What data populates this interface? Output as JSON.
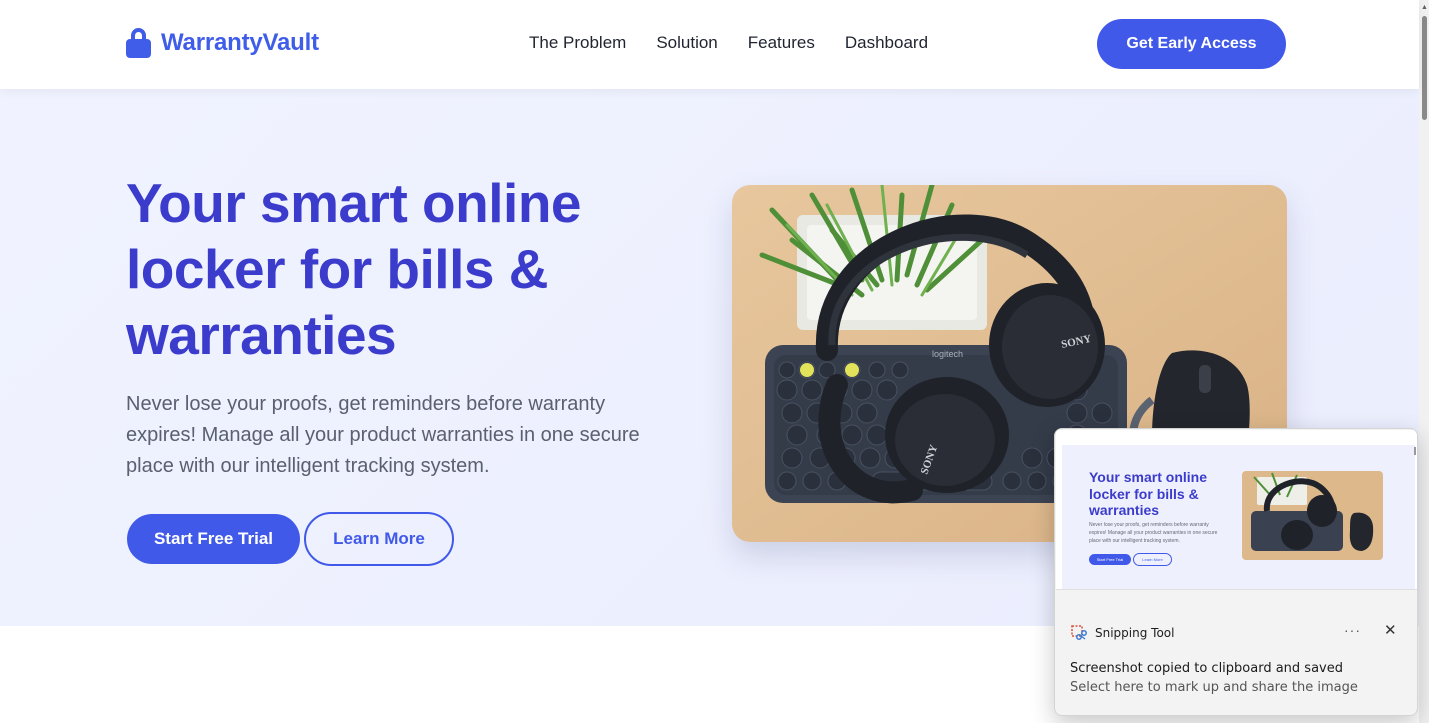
{
  "header": {
    "logo_text": "WarrantyVault",
    "logo_icon": "lock-icon",
    "nav": [
      "The Problem",
      "Solution",
      "Features",
      "Dashboard"
    ],
    "cta": "Get Early Access"
  },
  "hero": {
    "title": "Your smart online locker for bills & warranties",
    "subtitle": "Never lose your proofs, get reminders before warranty expires! Manage all your product warranties in one secure place with our intelligent tracking system.",
    "primary_button": "Start Free Trial",
    "secondary_button": "Learn More",
    "image_brands": {
      "keyboard": "logitech",
      "headphones": "SONY"
    }
  },
  "toast": {
    "app_name": "Snipping Tool",
    "message": "Screenshot copied to clipboard and saved",
    "submessage": "Select here to mark up and share the image",
    "more_icon": "more-icon",
    "close_icon": "close-icon",
    "thumbnail": {
      "title": "Your smart online locker for bills & warranties",
      "subtitle": "Never lose your proofs, get reminders before warranty expires! Manage all your product warranties in one secure place with our intelligent tracking system.",
      "primary_button": "Start Free Trial",
      "secondary_button": "Learn More"
    }
  },
  "colors": {
    "brand": "#4159e9",
    "title": "#3b3bcc",
    "hero_bg": "#eef1fd"
  }
}
